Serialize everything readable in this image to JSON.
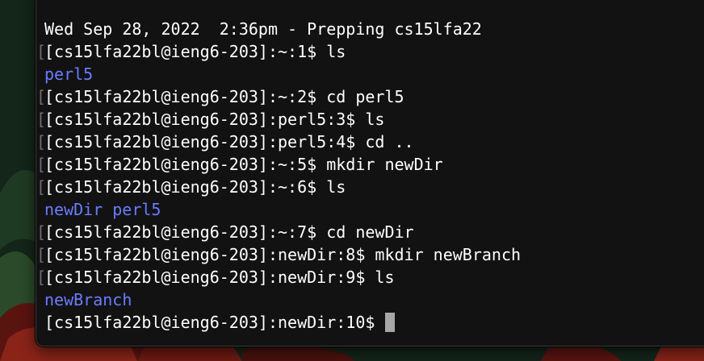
{
  "terminal": {
    "header": "Wed Sep 28, 2022  2:36pm - Prepping cs15lfa22",
    "bracket_mark": "[",
    "lines": [
      {
        "prompt": "[cs15lfa22bl@ieng6-203]:~:1$",
        "command": "ls"
      },
      {
        "output": [
          "perl5"
        ]
      },
      {
        "prompt": "[cs15lfa22bl@ieng6-203]:~:2$",
        "command": "cd perl5"
      },
      {
        "prompt": "[cs15lfa22bl@ieng6-203]:perl5:3$",
        "command": "ls"
      },
      {
        "prompt": "[cs15lfa22bl@ieng6-203]:perl5:4$",
        "command": "cd .."
      },
      {
        "prompt": "[cs15lfa22bl@ieng6-203]:~:5$",
        "command": "mkdir newDir"
      },
      {
        "prompt": "[cs15lfa22bl@ieng6-203]:~:6$",
        "command": "ls"
      },
      {
        "output": [
          "newDir",
          "perl5"
        ]
      },
      {
        "prompt": "[cs15lfa22bl@ieng6-203]:~:7$",
        "command": "cd newDir"
      },
      {
        "prompt": "[cs15lfa22bl@ieng6-203]:newDir:8$",
        "command": "mkdir newBranch"
      },
      {
        "prompt": "[cs15lfa22bl@ieng6-203]:newDir:9$",
        "command": "ls"
      },
      {
        "output": [
          "newBranch"
        ]
      }
    ],
    "current_prompt": "[cs15lfa22bl@ieng6-203]:newDir:10$",
    "colors": {
      "background": "#121212",
      "text": "#ffffff",
      "directory": "#6b7cff",
      "cursor": "#a6a6a6"
    }
  }
}
